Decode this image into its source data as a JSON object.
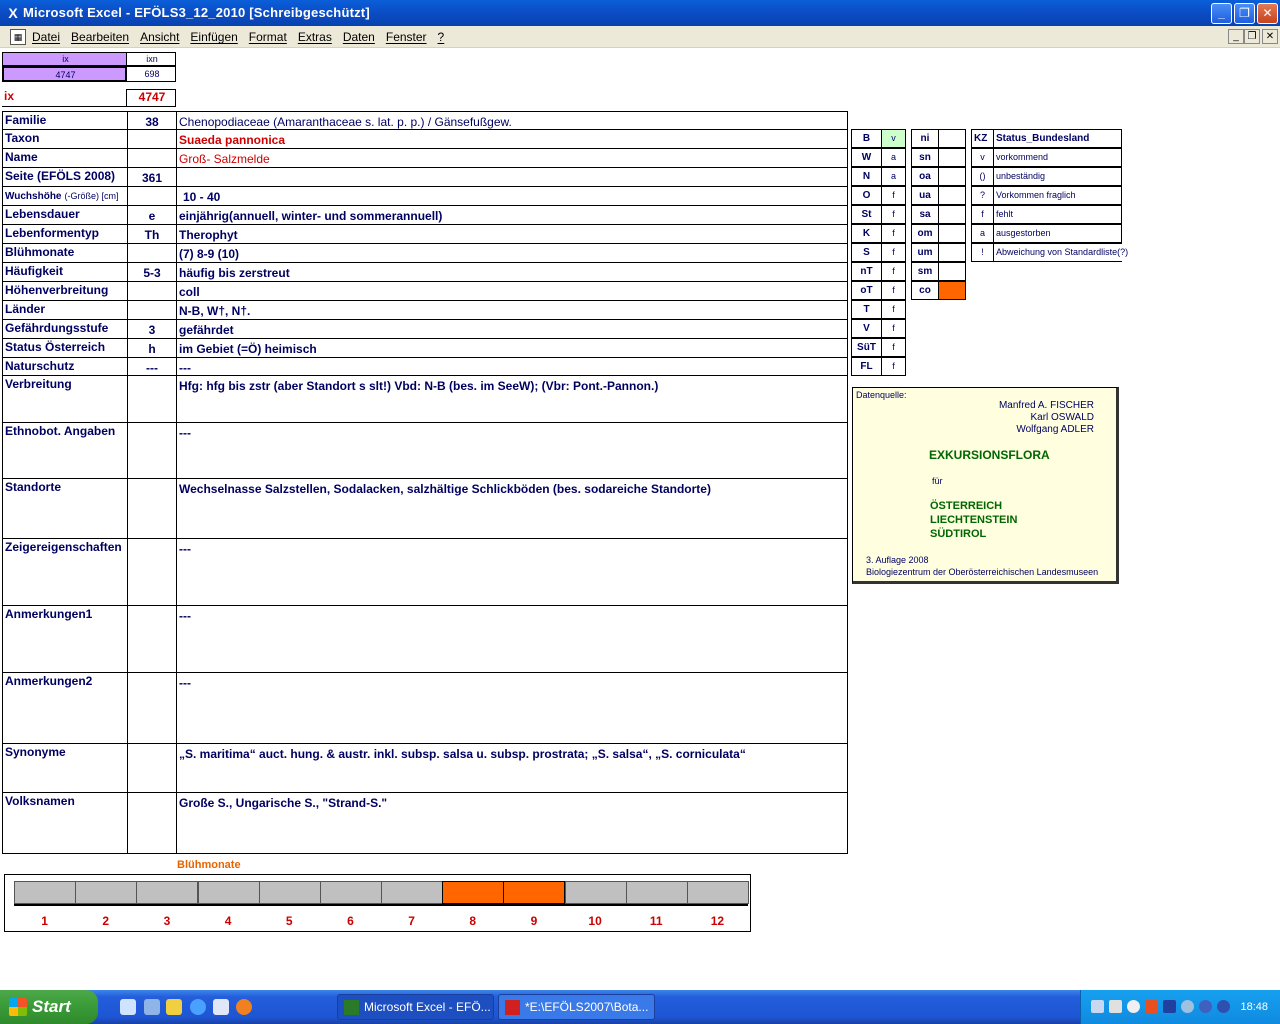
{
  "window": {
    "title": "Microsoft Excel - EFÖLS3_12_2010  [Schreibgeschützt]",
    "app_icon": "X",
    "btn_min": "_",
    "btn_max": "❐",
    "btn_close": "✕"
  },
  "menu": {
    "items": [
      "Datei",
      "Bearbeiten",
      "Ansicht",
      "Einfügen",
      "Format",
      "Extras",
      "Daten",
      "Fenster",
      "?"
    ],
    "mdi_min": "_",
    "mdi_restore": "❐",
    "mdi_close": "✕"
  },
  "top_cells": {
    "ix_header": "ix",
    "ixn_header": "ixn",
    "ix_value": "4747",
    "ixn_value": "698",
    "ix_label": "ix",
    "ix_big": "4747"
  },
  "rows": [
    {
      "label": "Familie",
      "code": "38",
      "value": "Chenopodiaceae (Amaranthaceae s. lat. p. p.)  /  Gänsefußgew."
    },
    {
      "label": "Taxon",
      "code": "",
      "value": "Suaeda pannonica"
    },
    {
      "label": "Name",
      "code": "",
      "value": "Groß- Salzmelde"
    },
    {
      "label": "Seite (EFÖLS 2008)",
      "code": "361",
      "value": ""
    },
    {
      "label": "Wuchshöhe",
      "label_suffix": "(-Größe) [cm]",
      "code": "",
      "value": "10 - 40"
    },
    {
      "label": "Lebensdauer",
      "code": "e",
      "value": "einjährig(annuell, winter- und sommerannuell)"
    },
    {
      "label": "Lebenformentyp",
      "code": "Th",
      "value": "Therophyt"
    },
    {
      "label": "Blühmonate",
      "code": "",
      "value": "(7) 8-9 (10)"
    },
    {
      "label": "Häufigkeit",
      "code": "5-3",
      "value": "häufig bis zerstreut"
    },
    {
      "label": "Höhenverbreitung",
      "code": "",
      "value": "coll"
    },
    {
      "label": "Länder",
      "code": "",
      "value": "N-B, W†, N†."
    },
    {
      "label": "Gefährdungsstufe",
      "code": "3",
      "value": "gefährdet"
    },
    {
      "label": "Status Österreich",
      "code": "h",
      "value": "im Gebiet (=Ö) heimisch"
    },
    {
      "label": "Naturschutz",
      "code": "---",
      "value": "---"
    },
    {
      "label": "Verbreitung",
      "code": "",
      "value": "Hfg: hfg bis zstr (aber Standort s slt!)  Vbd: N-B (bes. im SeeW);  (Vbr: Pont.-Pannon.)"
    },
    {
      "label": "Ethnobot. Angaben",
      "code": "",
      "value": "---"
    },
    {
      "label": "Standorte",
      "code": "",
      "value": "Wechselnasse Salzstellen, Sodalacken, salzhältige Schlickböden (bes. sodareiche Standorte)"
    },
    {
      "label": "Zeigereigenschaften",
      "code": "",
      "value": "---"
    },
    {
      "label": "Anmerkungen1",
      "code": "",
      "value": "---"
    },
    {
      "label": "Anmerkungen2",
      "code": "",
      "value": "---"
    },
    {
      "label": "Synonyme",
      "code": "",
      "value": "„S. maritima“ auct. hung. & austr. inkl. subsp. salsa u. subsp. prostrata; „S. salsa“, „S. corniculata“"
    },
    {
      "label": "Volksnamen",
      "code": "",
      "value": "Große S., Ungarische S., \"Strand-S.\""
    }
  ],
  "bundesland_grid": [
    {
      "k": "B",
      "v": "v"
    },
    {
      "k": "W",
      "v": "a"
    },
    {
      "k": "N",
      "v": "a"
    },
    {
      "k": "O",
      "v": "f"
    },
    {
      "k": "St",
      "v": "f"
    },
    {
      "k": "K",
      "v": "f"
    },
    {
      "k": "S",
      "v": "f"
    },
    {
      "k": "nT",
      "v": "f"
    },
    {
      "k": "oT",
      "v": "f"
    },
    {
      "k": "T",
      "v": "f"
    },
    {
      "k": "V",
      "v": "f"
    },
    {
      "k": "SüT",
      "v": "f"
    },
    {
      "k": "FL",
      "v": "f"
    }
  ],
  "region_grid": [
    {
      "k": "ni",
      "v": ""
    },
    {
      "k": "sn",
      "v": ""
    },
    {
      "k": "oa",
      "v": ""
    },
    {
      "k": "ua",
      "v": ""
    },
    {
      "k": "sa",
      "v": ""
    },
    {
      "k": "om",
      "v": ""
    },
    {
      "k": "um",
      "v": ""
    },
    {
      "k": "sm",
      "v": ""
    },
    {
      "k": "co",
      "v": ""
    }
  ],
  "legend": {
    "header_kz": "KZ",
    "header_status": "Status_Bundesland",
    "items": [
      {
        "k": "v",
        "v": "vorkommend"
      },
      {
        "k": "()",
        "v": "unbeständig"
      },
      {
        "k": "?",
        "v": "Vorkommen fraglich"
      },
      {
        "k": "f",
        "v": "fehlt"
      },
      {
        "k": "a",
        "v": "ausgestorben"
      },
      {
        "k": "!",
        "v": "Abweichung von Standardliste(?)"
      }
    ]
  },
  "datenquelle": {
    "label": "Datenquelle:",
    "author1": "Manfred A. FISCHER",
    "author2": "Karl OSWALD",
    "author3": "Wolfgang ADLER",
    "title": "EXKURSIONSFLORA",
    "fuer": "für",
    "country1": "ÖSTERREICH",
    "country2": "LIECHTENSTEIN",
    "country3": "SÜDTIROL",
    "edition": "3. Auflage 2008",
    "publisher": "Biologiezentrum der Oberösterreichischen Landesmuseen"
  },
  "bluehmonate_chart": {
    "label": "Blühmonate",
    "months": [
      "1",
      "2",
      "3",
      "4",
      "5",
      "6",
      "7",
      "8",
      "9",
      "10",
      "11",
      "12"
    ],
    "active": [
      false,
      false,
      false,
      false,
      false,
      false,
      false,
      true,
      true,
      false,
      false,
      false
    ],
    "color_active": "#ff6600",
    "color_inactive": "#c0c0c0"
  },
  "taskbar": {
    "start": "Start",
    "task1": "Microsoft Excel - EFÖ...",
    "task2": "*E:\\EFÖLS2007\\Bota...",
    "clock": "18:48"
  },
  "colors": {
    "ix_header_bg": "#cc99ff",
    "active_orange": "#ff6600",
    "green_cell": "#ccffcc"
  }
}
